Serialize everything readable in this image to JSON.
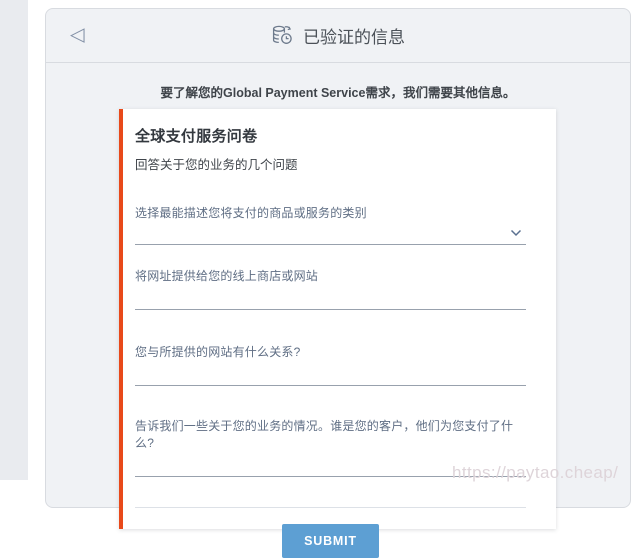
{
  "header": {
    "title": "已验证的信息",
    "back_icon": "◁",
    "title_icon": "coins-clock"
  },
  "intro_text": "要了解您的Global Payment Service需求，我们需要其他信息。",
  "form": {
    "title": "全球支付服务问卷",
    "subtitle": "回答关于您的业务的几个问题",
    "fields": [
      {
        "label": "选择最能描述您将支付的商品或服务的类别",
        "type": "select",
        "value": ""
      },
      {
        "label": "将网址提供给您的线上商店或网站",
        "type": "text",
        "value": ""
      },
      {
        "label": "您与所提供的网站有什么关系?",
        "type": "text",
        "value": ""
      },
      {
        "label": "告诉我们一些关于您的业务的情况。谁是您的客户，他们为您支付了什么?",
        "type": "text",
        "value": ""
      }
    ],
    "submit_label": "SUBMIT"
  },
  "watermark_text": "https://paytao.cheap/",
  "colors": {
    "accent_orange": "#e8491a",
    "submit_blue": "#5d9fd3",
    "card_background": "#f0f2f5",
    "card_border": "#d8dbe0",
    "label_gray_blue": "#5f6e84"
  }
}
